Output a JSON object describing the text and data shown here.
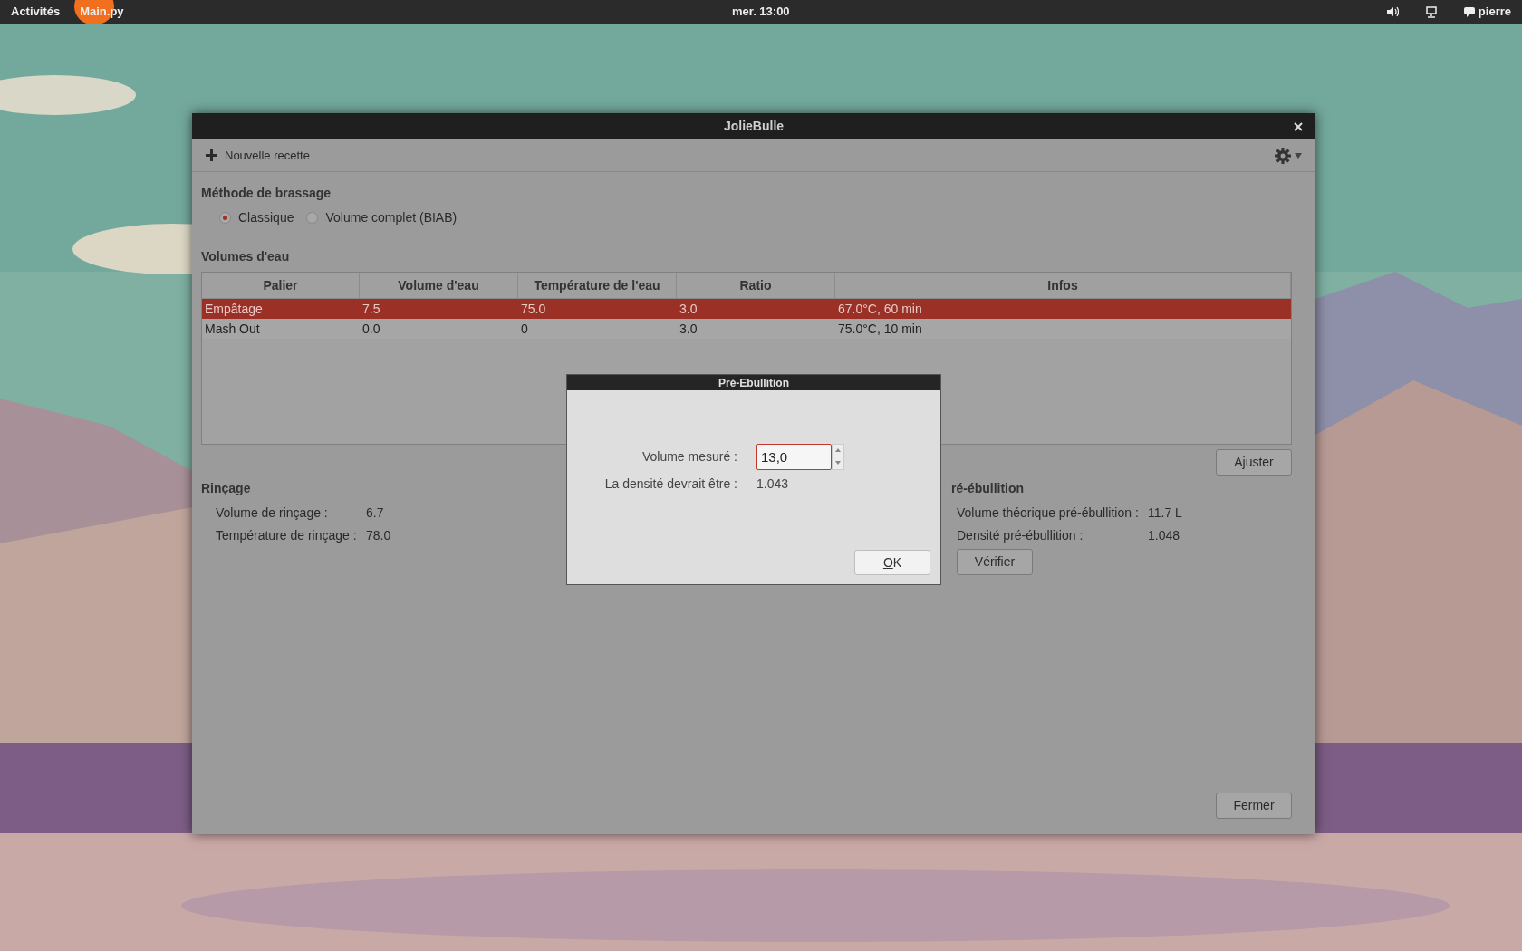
{
  "top_bar": {
    "activities": "Activités",
    "app_name": "Main.py",
    "clock": "mer. 13:00",
    "user": "pierre"
  },
  "window": {
    "title": "JolieBulle",
    "new_recipe": "Nouvelle recette",
    "method": {
      "heading": "Méthode de brassage",
      "options": [
        {
          "label": "Classique",
          "selected": true
        },
        {
          "label": "Volume complet (BIAB)",
          "selected": false
        }
      ]
    },
    "water": {
      "heading": "Volumes d'eau",
      "columns": [
        "Palier",
        "Volume d'eau",
        "Température de l'eau",
        "Ratio",
        "Infos"
      ],
      "rows": [
        {
          "cells": [
            "Empâtage",
            "7.5",
            "75.0",
            "3.0",
            "67.0°C, 60 min"
          ],
          "selected": true
        },
        {
          "cells": [
            "Mash Out",
            "0.0",
            "0",
            "3.0",
            "75.0°C, 10 min"
          ],
          "selected": false
        }
      ],
      "adjust_button": "Ajuster"
    },
    "rinse": {
      "heading": "Rinçage",
      "fields": [
        {
          "label": "Volume de rinçage :",
          "value": "6.7"
        },
        {
          "label": "Température de rinçage :",
          "value": "78.0"
        }
      ]
    },
    "pre_boil": {
      "heading": "ré-ébullition",
      "fields": [
        {
          "label": "Volume théorique pré-ébullition :",
          "value": "11.7 L"
        },
        {
          "label": "Densité pré-ébullition :",
          "value": "1.048"
        }
      ],
      "verify_button": "Vérifier"
    },
    "close_button": "Fermer"
  },
  "dialog": {
    "title": "Pré-Ebullition",
    "fields": [
      {
        "kind": "spin",
        "label": "Volume mesuré :",
        "value": "13,0"
      },
      {
        "kind": "text",
        "label": "La densité devrait être :",
        "value": "1.043"
      }
    ],
    "ok_button": "OK"
  }
}
